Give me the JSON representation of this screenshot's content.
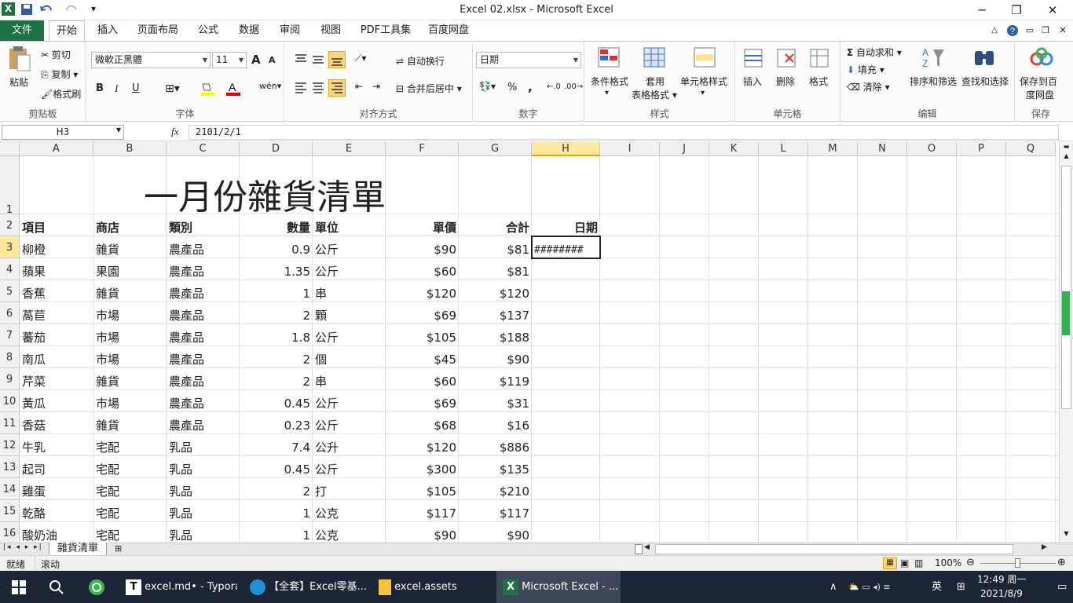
{
  "window": {
    "title": "Excel 02.xlsx  -  Microsoft Excel",
    "logo": "X"
  },
  "tabs": [
    "文件",
    "开始",
    "插入",
    "页面布局",
    "公式",
    "数据",
    "审阅",
    "视图",
    "PDF工具集",
    "百度网盘"
  ],
  "ribbon": {
    "clipboard": {
      "paste": "粘贴",
      "cut": "剪切",
      "copy": "复制",
      "format_painter": "格式刷",
      "label": "剪贴板"
    },
    "font": {
      "name": "微軟正黑體",
      "size": "11",
      "label": "字体",
      "bold": "B",
      "italic": "I",
      "underline": "U",
      "grow": "A",
      "shrink": "A"
    },
    "align": {
      "wrap": "自动换行",
      "merge": "合并后居中",
      "label": "对齐方式"
    },
    "number": {
      "format": "日期",
      "label": "数字",
      "percent": "%",
      "comma": ","
    },
    "styles": {
      "conditional": "条件格式",
      "table": "套用",
      "table2": "表格格式",
      "cell": "单元格样式",
      "label": "样式"
    },
    "cells": {
      "insert": "插入",
      "delete": "删除",
      "format": "格式",
      "label": "单元格"
    },
    "edit": {
      "autosum": "自动求和",
      "fill": "填充",
      "clear": "清除",
      "sort": "排序和筛选",
      "find": "查找和选择",
      "label": "编辑",
      "sigma": "Σ"
    },
    "save": {
      "label1": "保存到百",
      "label2": "度网盘",
      "group": "保存"
    }
  },
  "formula_bar": {
    "name_box": "H3",
    "fx": "fx",
    "value": "2101/2/1"
  },
  "columns": [
    "A",
    "B",
    "C",
    "D",
    "E",
    "F",
    "G",
    "H",
    "I",
    "J",
    "K",
    "L",
    "M",
    "N",
    "O",
    "P",
    "Q"
  ],
  "rows": [
    "1",
    "2",
    "3",
    "4",
    "5",
    "6",
    "7",
    "8",
    "9",
    "10",
    "11",
    "12",
    "13",
    "14",
    "15",
    "16"
  ],
  "sheet_title": "一月份雜貨清單",
  "headers": {
    "a": "項目",
    "b": "商店",
    "c": "類別",
    "d": "數量",
    "e": "單位",
    "f": "單價",
    "g": "合計",
    "h": "日期"
  },
  "data": [
    {
      "a": "柳橙",
      "b": "雜貨",
      "c": "農產品",
      "d": "0.9",
      "e": "公斤",
      "f": "$90",
      "g": "$81",
      "h": "########"
    },
    {
      "a": "蘋果",
      "b": "果園",
      "c": "農產品",
      "d": "1.35",
      "e": "公斤",
      "f": "$60",
      "g": "$81",
      "h": ""
    },
    {
      "a": "香蕉",
      "b": "雜貨",
      "c": "農產品",
      "d": "1",
      "e": "串",
      "f": "$120",
      "g": "$120",
      "h": ""
    },
    {
      "a": "萵苣",
      "b": "市場",
      "c": "農產品",
      "d": "2",
      "e": "顆",
      "f": "$69",
      "g": "$137",
      "h": ""
    },
    {
      "a": "蕃茄",
      "b": "市場",
      "c": "農產品",
      "d": "1.8",
      "e": "公斤",
      "f": "$105",
      "g": "$188",
      "h": ""
    },
    {
      "a": "南瓜",
      "b": "市場",
      "c": "農產品",
      "d": "2",
      "e": "個",
      "f": "$45",
      "g": "$90",
      "h": ""
    },
    {
      "a": "芹菜",
      "b": "雜貨",
      "c": "農產品",
      "d": "2",
      "e": "串",
      "f": "$60",
      "g": "$119",
      "h": ""
    },
    {
      "a": "黃瓜",
      "b": "市場",
      "c": "農產品",
      "d": "0.45",
      "e": "公斤",
      "f": "$69",
      "g": "$31",
      "h": ""
    },
    {
      "a": "香菇",
      "b": "雜貨",
      "c": "農產品",
      "d": "0.23",
      "e": "公斤",
      "f": "$68",
      "g": "$16",
      "h": ""
    },
    {
      "a": "牛乳",
      "b": "宅配",
      "c": "乳品",
      "d": "7.4",
      "e": "公升",
      "f": "$120",
      "g": "$886",
      "h": ""
    },
    {
      "a": "起司",
      "b": "宅配",
      "c": "乳品",
      "d": "0.45",
      "e": "公斤",
      "f": "$300",
      "g": "$135",
      "h": ""
    },
    {
      "a": "雞蛋",
      "b": "宅配",
      "c": "乳品",
      "d": "2",
      "e": "打",
      "f": "$105",
      "g": "$210",
      "h": ""
    },
    {
      "a": "乾酪",
      "b": "宅配",
      "c": "乳品",
      "d": "1",
      "e": "公克",
      "f": "$117",
      "g": "$117",
      "h": ""
    },
    {
      "a": "酸奶油",
      "b": "宅配",
      "c": "乳品",
      "d": "1",
      "e": "公克",
      "f": "$90",
      "g": "$90",
      "h": ""
    }
  ],
  "sheet_tab": "雜貨清單",
  "status": {
    "ready": "就绪",
    "scroll": "滚动",
    "zoom": "100%"
  },
  "taskbar": {
    "items": [
      "excel.md• - Typora",
      "【全套】Excel零基...",
      "excel.assets",
      "Microsoft Excel - ..."
    ],
    "time": "12:49 周一",
    "date": "2021/8/9",
    "ime": "英"
  },
  "colors": {
    "excel_green": "#1e7145",
    "selected_header": "#fde89a",
    "taskbar": "#1b2535"
  }
}
